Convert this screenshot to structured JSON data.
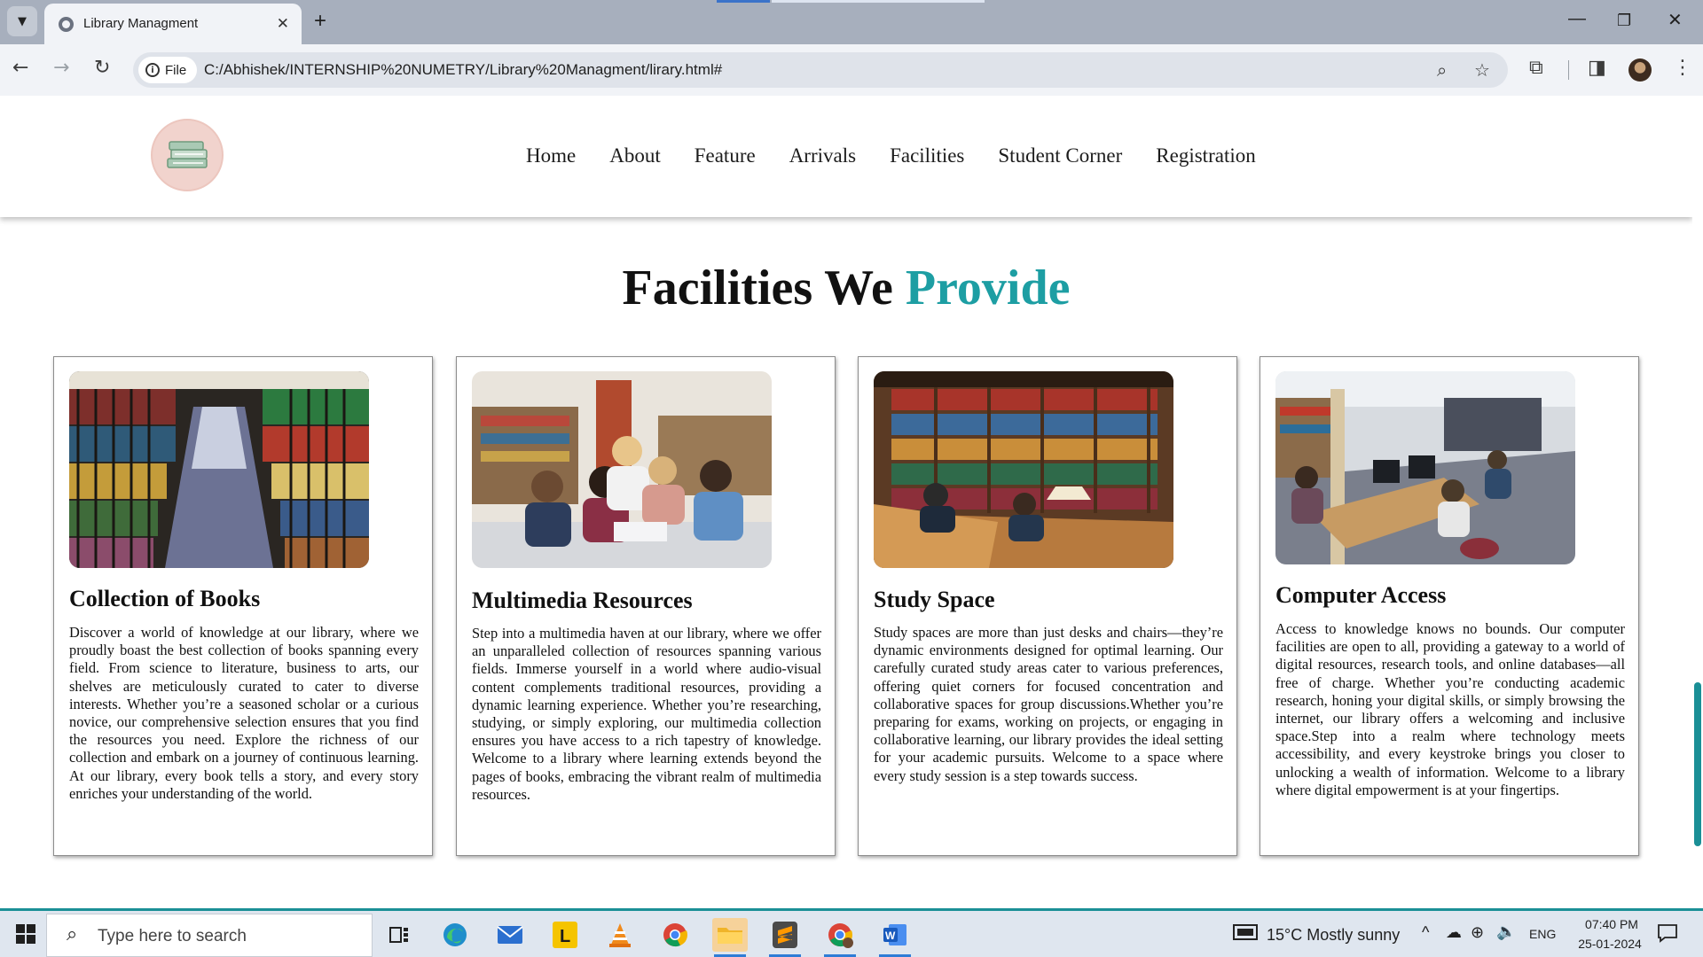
{
  "browser": {
    "tab_title": "Library Managment",
    "tab_close": "✕",
    "new_tab": "+",
    "file_label": "File",
    "url": "C:/Abhishek/INTERNSHIP%20NUMETRY/Library%20Managment/lirary.html#",
    "window_controls": {
      "minimize": "—",
      "restore": "❐",
      "close": "✕"
    }
  },
  "site": {
    "nav": [
      "Home",
      "About",
      "Feature",
      "Arrivals",
      "Facilities",
      "Student Corner",
      "Registration"
    ],
    "section_title": {
      "main": "Facilities We",
      "accent": "Provide"
    },
    "accent_color": "#1d9ea3",
    "cards": [
      {
        "title": "Collection of Books",
        "text": "Discover a world of knowledge at our library, where we proudly boast the best collection of books spanning every field. From science to literature, business to arts, our shelves are meticulously curated to cater to diverse interests. Whether you’re a seasoned scholar or a curious novice, our comprehensive selection ensures that you find the resources you need. Explore the richness of our collection and embark on a journey of continuous learning. At our library, every book tells a story, and every story enriches your understanding of the world."
      },
      {
        "title": "Multimedia Resources",
        "text": "Step into a multimedia haven at our library, where we offer an unparalleled collection of resources spanning various fields. Immerse yourself in a world where audio-visual content complements traditional resources, providing a dynamic learning experience. Whether you’re researching, studying, or simply exploring, our multimedia collection ensures you have access to a rich tapestry of knowledge. Welcome to a library where learning extends beyond the pages of books, embracing the vibrant realm of multimedia resources."
      },
      {
        "title": "Study Space",
        "text": "Study spaces are more than just desks and chairs—they’re dynamic environments designed for optimal learning. Our carefully curated study areas cater to various preferences, offering quiet corners for focused concentration and collaborative spaces for group discussions.Whether you’re preparing for exams, working on projects, or engaging in collaborative learning, our library provides the ideal setting for your academic pursuits. Welcome to a space where every study session is a step towards success."
      },
      {
        "title": "Computer Access",
        "text": "Access to knowledge knows no bounds. Our computer facilities are open to all, providing a gateway to a world of digital resources, research tools, and online databases—all free of charge. Whether you’re conducting academic research, honing your digital skills, or simply browsing the internet, our library offers a welcoming and inclusive space.Step into a realm where technology meets accessibility, and every keystroke brings you closer to unlocking a wealth of information. Welcome to a library where digital empowerment is at your fingertips."
      }
    ]
  },
  "taskbar": {
    "search_placeholder": "Type here to search",
    "weather": "15°C  Mostly sunny",
    "language": "ENG",
    "time": "07:40 PM",
    "date": "25-01-2024"
  }
}
